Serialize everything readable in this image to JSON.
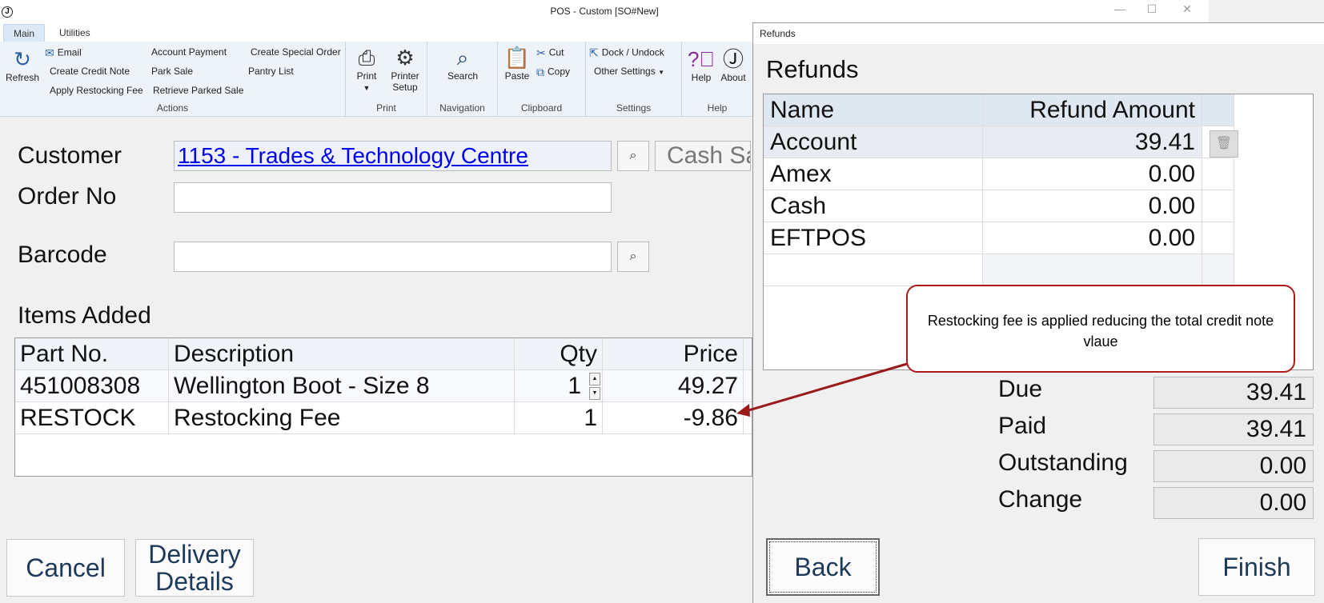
{
  "window": {
    "title": "POS - Custom [SO#New]",
    "app_icon": "J",
    "controls": {
      "minimize": "—",
      "maximize": "☐",
      "close": "✕"
    }
  },
  "ribbon": {
    "tabs": [
      {
        "label": "Main",
        "active": true
      },
      {
        "label": "Utilities",
        "active": false
      }
    ],
    "groups": {
      "actions": {
        "label": "Actions",
        "refresh": "Refresh",
        "email": "Email",
        "create_credit_note": "Create Credit Note",
        "apply_restocking_fee": "Apply Restocking Fee",
        "account_payment": "Account Payment",
        "park_sale": "Park Sale",
        "retrieve_parked_sale": "Retrieve Parked Sale",
        "create_special_order": "Create Special Order",
        "pantry_list": "Pantry List"
      },
      "print": {
        "label": "Print",
        "print": "Print",
        "printer_setup_1": "Printer",
        "printer_setup_2": "Setup"
      },
      "navigation": {
        "label": "Navigation",
        "search": "Search"
      },
      "clipboard": {
        "label": "Clipboard",
        "paste": "Paste",
        "cut": "Cut",
        "copy": "Copy"
      },
      "settings": {
        "label": "Settings",
        "dock_undock": "Dock / Undock",
        "other_settings": "Other Settings"
      },
      "help": {
        "label": "Help",
        "help": "Help",
        "about": "About"
      }
    }
  },
  "form": {
    "customer_label": "Customer",
    "customer_value": "1153 - Trades & Technology Centre",
    "cash_sale": "Cash Sale",
    "order_no_label": "Order No",
    "order_no_value": "",
    "barcode_label": "Barcode",
    "barcode_value": ""
  },
  "items": {
    "heading": "Items Added",
    "columns": {
      "part_no": "Part No.",
      "description": "Description",
      "qty": "Qty",
      "price": "Price"
    },
    "rows": [
      {
        "part_no": "451008308",
        "description": "Wellington Boot - Size 8",
        "qty": "1",
        "price": "49.27"
      },
      {
        "part_no": "RESTOCK",
        "description": "Restocking Fee",
        "qty": "1",
        "price": "-9.86"
      }
    ]
  },
  "buttons": {
    "cancel": "Cancel",
    "delivery_1": "Delivery",
    "delivery_2": "Details"
  },
  "refunds": {
    "window_title": "Refunds",
    "heading": "Refunds",
    "columns": {
      "name": "Name",
      "amount": "Refund Amount"
    },
    "rows": [
      {
        "name": "Account",
        "amount": "39.41"
      },
      {
        "name": "Amex",
        "amount": "0.00"
      },
      {
        "name": "Cash",
        "amount": "0.00"
      },
      {
        "name": "EFTPOS",
        "amount": "0.00"
      }
    ],
    "summary": {
      "due_label": "Due",
      "due": "39.41",
      "paid_label": "Paid",
      "paid": "39.41",
      "outstanding_label": "Outstanding",
      "outstanding": "0.00",
      "change_label": "Change",
      "change": "0.00"
    },
    "back": "Back",
    "finish": "Finish"
  },
  "callout": {
    "text": "Restocking fee is applied reducing the total credit note vlaue",
    "color": "#b01919"
  }
}
